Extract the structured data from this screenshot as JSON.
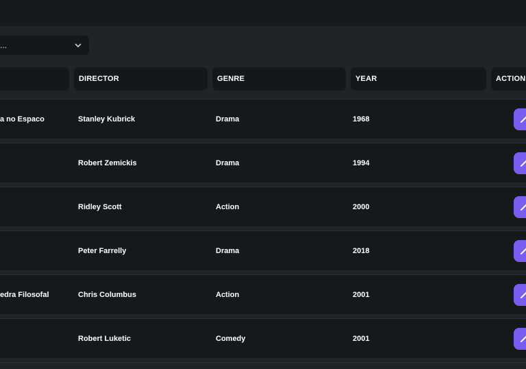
{
  "filter": {
    "value": "..."
  },
  "table": {
    "headers": [
      "DIRECTOR",
      "GENRE",
      "YEAR",
      "ACTION"
    ],
    "rows": [
      {
        "title": "a no Espaco",
        "director": "Stanley Kubrick",
        "genre": "Drama",
        "year": "1968"
      },
      {
        "title": "",
        "director": "Robert Zemickis",
        "genre": "Drama",
        "year": "1994"
      },
      {
        "title": "",
        "director": "Ridley Scott",
        "genre": "Action",
        "year": "2000"
      },
      {
        "title": "",
        "director": "Peter Farrelly",
        "genre": "Drama",
        "year": "2018"
      },
      {
        "title": "edra Filosofal",
        "director": "Chris Columbus",
        "genre": "Action",
        "year": "2001"
      },
      {
        "title": "",
        "director": "Robert Luketic",
        "genre": "Comedy",
        "year": "2001"
      }
    ]
  },
  "colors": {
    "accent": "#7b5cf0",
    "background": "#1f2426",
    "row": "#16191c"
  },
  "icons": {
    "filter": "chevron-down-icon",
    "action": "pencil-icon"
  }
}
